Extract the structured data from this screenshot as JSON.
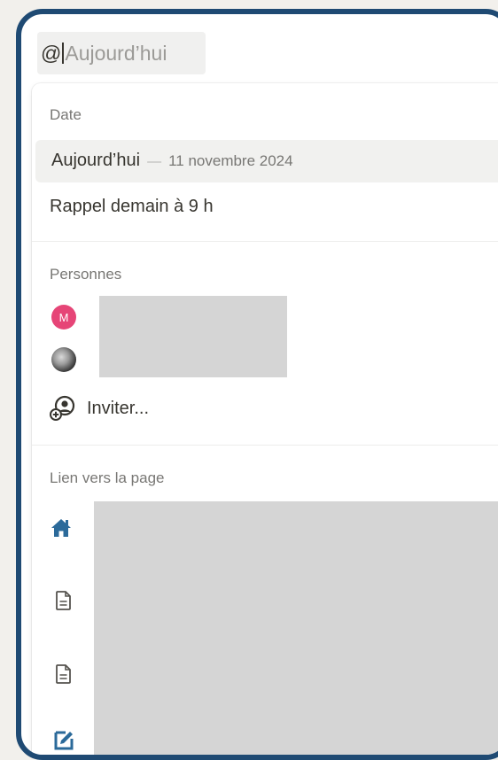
{
  "input": {
    "prefix": "@",
    "query": "Aujourd’hui"
  },
  "date_section": {
    "title": "Date",
    "today_label": "Aujourd’hui",
    "today_separator": "—",
    "today_date": "11 novembre 2024",
    "reminder_label": "Rappel demain à 9 h"
  },
  "people_section": {
    "title": "Personnes",
    "avatar_initial": "M",
    "invite_label": "Inviter..."
  },
  "link_section": {
    "title": "Lien vers la page"
  },
  "colors": {
    "frame": "#1f4a73",
    "avatar_m": "#e64577",
    "home_icon": "#2b6a9a",
    "edit_icon": "#2b6a9a"
  }
}
